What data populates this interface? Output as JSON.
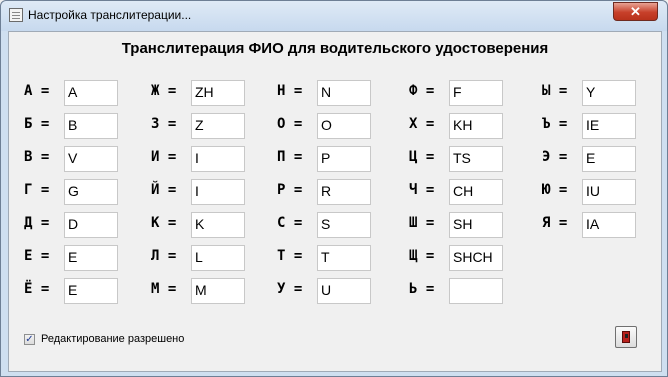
{
  "window": {
    "title": "Настройка транслитерации...",
    "close_label": "✕"
  },
  "heading": "Транслитерация ФИО для водительского удостоверения",
  "pairs": [
    {
      "letter": "А =",
      "value": "A"
    },
    {
      "letter": "Б =",
      "value": "B"
    },
    {
      "letter": "В =",
      "value": "V"
    },
    {
      "letter": "Г =",
      "value": "G"
    },
    {
      "letter": "Д =",
      "value": "D"
    },
    {
      "letter": "Е =",
      "value": "E"
    },
    {
      "letter": "Ё =",
      "value": "E"
    },
    {
      "letter": "Ж =",
      "value": "ZH"
    },
    {
      "letter": "З =",
      "value": "Z"
    },
    {
      "letter": "И =",
      "value": "I"
    },
    {
      "letter": "Й =",
      "value": "I"
    },
    {
      "letter": "К =",
      "value": "K"
    },
    {
      "letter": "Л =",
      "value": "L"
    },
    {
      "letter": "М =",
      "value": "M"
    },
    {
      "letter": "Н =",
      "value": "N"
    },
    {
      "letter": "О =",
      "value": "O"
    },
    {
      "letter": "П =",
      "value": "P"
    },
    {
      "letter": "Р =",
      "value": "R"
    },
    {
      "letter": "С =",
      "value": "S"
    },
    {
      "letter": "Т =",
      "value": "T"
    },
    {
      "letter": "У =",
      "value": "U"
    },
    {
      "letter": "Ф =",
      "value": "F"
    },
    {
      "letter": "Х =",
      "value": "KH"
    },
    {
      "letter": "Ц =",
      "value": "TS"
    },
    {
      "letter": "Ч =",
      "value": "CH"
    },
    {
      "letter": "Ш =",
      "value": "SH"
    },
    {
      "letter": "Щ =",
      "value": "SHCH"
    },
    {
      "letter": "Ь =",
      "value": ""
    },
    {
      "letter": "Ы =",
      "value": "Y"
    },
    {
      "letter": "Ъ =",
      "value": "IE"
    },
    {
      "letter": "Э =",
      "value": "E"
    },
    {
      "letter": "Ю =",
      "value": "IU"
    },
    {
      "letter": "Я =",
      "value": "IA"
    }
  ],
  "editing": {
    "label": "Редактирование разрешено",
    "checked": true,
    "check_mark": "✓"
  },
  "exit_button": {
    "icon": "exit-door-icon"
  }
}
